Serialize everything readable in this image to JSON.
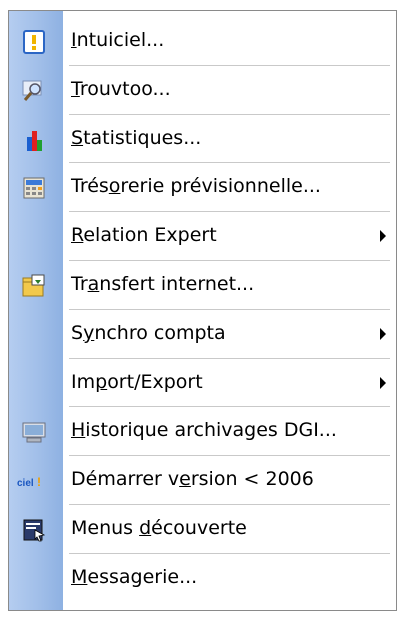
{
  "menu": {
    "items": [
      {
        "id": "intuiciel",
        "pre": "",
        "acc": "I",
        "post": "ntuiciel...",
        "icon": "info-exclamation-icon",
        "submenu": false
      },
      {
        "id": "trouvtoo",
        "pre": "",
        "acc": "T",
        "post": "rouvtoo...",
        "icon": "search-magnifier-icon",
        "submenu": false
      },
      {
        "id": "statistiques",
        "pre": "",
        "acc": "S",
        "post": "tatistiques...",
        "icon": "bar-chart-icon",
        "submenu": false
      },
      {
        "id": "tresorerie",
        "pre": "Trés",
        "acc": "o",
        "post": "rerie prévisionnelle...",
        "icon": "calculator-spreadsheet-icon",
        "submenu": false
      },
      {
        "id": "relation-expert",
        "pre": "",
        "acc": "R",
        "post": "elation Expert",
        "icon": "",
        "submenu": true
      },
      {
        "id": "transfert-internet",
        "pre": "Tr",
        "acc": "a",
        "post": "nsfert internet...",
        "icon": "folder-transfer-icon",
        "submenu": false
      },
      {
        "id": "synchro-compta",
        "pre": "S",
        "acc": "y",
        "post": "nchro compta",
        "icon": "",
        "submenu": true
      },
      {
        "id": "import-export",
        "pre": "Im",
        "acc": "p",
        "post": "ort/Export",
        "icon": "",
        "submenu": true
      },
      {
        "id": "historique",
        "pre": "",
        "acc": "H",
        "post": "istorique archivages DGI...",
        "icon": "archive-computer-icon",
        "submenu": false
      },
      {
        "id": "demarrer",
        "pre": "Démarrer v",
        "acc": "e",
        "post": "rsion < 2006",
        "icon": "ciel-logo-icon",
        "submenu": false
      },
      {
        "id": "menus-decouverte",
        "pre": "Menus ",
        "acc": "d",
        "post": "écouverte",
        "icon": "menu-window-icon",
        "submenu": false
      },
      {
        "id": "messagerie",
        "pre": "",
        "acc": "M",
        "post": "essagerie...",
        "icon": "",
        "submenu": false
      }
    ],
    "ciel_logo_text": "ciel"
  }
}
